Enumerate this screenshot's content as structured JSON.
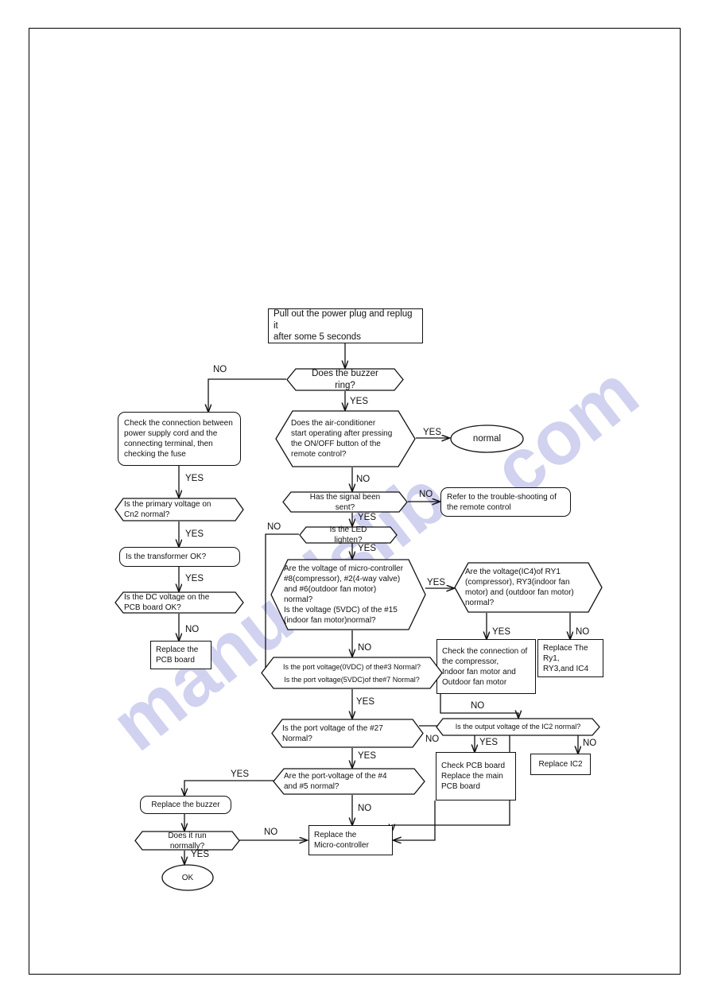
{
  "document": {
    "type": "troubleshooting-flowchart",
    "page_border": true
  },
  "watermark": {
    "text": "manualslib",
    "secondary": "com",
    "color": "#c9c9ee"
  },
  "labels": {
    "no": "NO",
    "yes": "YES"
  },
  "nodes": {
    "start": {
      "shape": "rect",
      "line1": "Pull out the power plug and replug it",
      "line2": "after some 5 seconds"
    },
    "buzzer_ring": {
      "shape": "hexagon",
      "line1": "Does the buzzer ring?"
    },
    "check_connection": {
      "shape": "rounded-rect",
      "line1": "Check the connection between",
      "line2": "power supply cord and the",
      "line3": "connecting terminal, then",
      "line4": "checking the fuse"
    },
    "ac_start": {
      "shape": "hexagon",
      "line1": "Does   the   air-conditioner",
      "line2": "start  operating  after  pressing",
      "line3": "the   ON/OFF   button   of   the",
      "line4": "remote control?"
    },
    "normal": {
      "shape": "oval",
      "line1": "normal"
    },
    "primary_voltage": {
      "shape": "hexagon",
      "line1": "Is the primary voltage on",
      "line2": "Cn2 normal?"
    },
    "signal_sent": {
      "shape": "hexagon",
      "line1": "Has the signal been sent?"
    },
    "refer_remote": {
      "shape": "rounded-rect",
      "line1": "Refer to the trouble-shooting of",
      "line2": "the remote control"
    },
    "led_lighten": {
      "shape": "hexagon",
      "line1": "Is the LED lighten?"
    },
    "transformer_ok": {
      "shape": "rounded-rect",
      "line1": "Is the transformer OK?"
    },
    "micro_voltage": {
      "shape": "hexagon",
      "line1": "Are the voltage of micro-controller",
      "line2": "#8(compressor),  #2(4-way  valve)",
      "line3": "and     #6(outdoor     fan     motor)",
      "line4": "normal?",
      "line5": "Is the voltage (5VDC) of the #15",
      "line6": "(indoor fan motor)normal?"
    },
    "ic4_voltage": {
      "shape": "hexagon",
      "line1": "Are the voltage(IC4)of RY1",
      "line2": "(compressor), RY3(indoor fan",
      "line3": "motor) and (outdoor fan motor)",
      "line4": "normal?"
    },
    "dc_voltage": {
      "shape": "hexagon",
      "line1": "Is  the  DC  voltage  on  the",
      "line2": "PCB board OK?"
    },
    "check_compressor": {
      "shape": "rect",
      "line1": "Check  the  connection  of",
      "line2": "the compressor,",
      "line3": "Indoor   fan   motor   and",
      "line4": "Outdoor fan motor"
    },
    "replace_ry": {
      "shape": "rect",
      "line1": "Replace The Ry1,",
      "line2": "RY3,and IC4"
    },
    "replace_pcb": {
      "shape": "rect",
      "line1": "Replace  the",
      "line2": "PCB board"
    },
    "port_voltage_3_7": {
      "shape": "hexagon",
      "line1": "Is the port voltage(0VDC) of the#3 Normal?",
      "line2": "Is the port voltage(5VDC)of the#7 Normal?"
    },
    "port_voltage_27": {
      "shape": "hexagon",
      "line1": "Is  the  port  voltage  of  the  #27",
      "line2": "Normal?"
    },
    "ic2_output": {
      "shape": "hexagon",
      "line1": "Is the output voltage of the IC2 normal?"
    },
    "check_pcb": {
      "shape": "rect",
      "line1": "Check PCB board",
      "line2": "Replace the main",
      "line3": "PCB board"
    },
    "replace_ic2": {
      "shape": "rect",
      "line1": "Replace IC2"
    },
    "port_voltage_4_5": {
      "shape": "hexagon",
      "line1": "Are  the  port-voltage  of  the  #4",
      "line2": "and #5 normal?"
    },
    "replace_buzzer": {
      "shape": "rounded-rect",
      "line1": "Replace the buzzer"
    },
    "run_normally": {
      "shape": "hexagon",
      "line1": "Does it run normally?"
    },
    "replace_micro": {
      "shape": "rect",
      "line1": "Replace the",
      "line2": "Micro-controller"
    },
    "ok": {
      "shape": "oval",
      "line1": "OK"
    }
  },
  "edge_labels": [
    {
      "id": "e-buzzer-no",
      "text": "NO"
    },
    {
      "id": "e-buzzer-yes",
      "text": "YES"
    },
    {
      "id": "e-check-yes",
      "text": "YES"
    },
    {
      "id": "e-ac-yes",
      "text": "YES"
    },
    {
      "id": "e-ac-no",
      "text": "NO"
    },
    {
      "id": "e-signal-no",
      "text": "NO"
    },
    {
      "id": "e-signal-yes",
      "text": "YES"
    },
    {
      "id": "e-primary-yes",
      "text": "YES"
    },
    {
      "id": "e-led-no",
      "text": "NO"
    },
    {
      "id": "e-led-yes",
      "text": "YES"
    },
    {
      "id": "e-transformer-yes",
      "text": "YES"
    },
    {
      "id": "e-micro-yes",
      "text": "YES"
    },
    {
      "id": "e-micro-no",
      "text": "NO"
    },
    {
      "id": "e-dc-no",
      "text": "NO"
    },
    {
      "id": "e-ic4-yes",
      "text": "YES"
    },
    {
      "id": "e-ic4-no",
      "text": "NO"
    },
    {
      "id": "e-compressor-no",
      "text": "NO"
    },
    {
      "id": "e-port37-yes",
      "text": "YES"
    },
    {
      "id": "e-port27-yes",
      "text": "YES"
    },
    {
      "id": "e-port27-no",
      "text": "NO"
    },
    {
      "id": "e-ic2-yes",
      "text": "YES"
    },
    {
      "id": "e-ic2-no",
      "text": "NO"
    },
    {
      "id": "e-port45-yes",
      "text": "YES"
    },
    {
      "id": "e-port45-no",
      "text": "NO"
    },
    {
      "id": "e-run-no",
      "text": "NO"
    },
    {
      "id": "e-run-yes",
      "text": "YES"
    }
  ]
}
